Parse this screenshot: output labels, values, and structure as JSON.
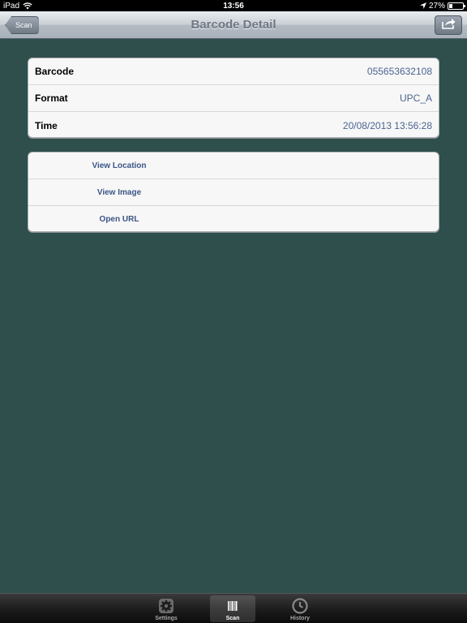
{
  "status_bar": {
    "device": "iPad",
    "time": "13:56",
    "battery": "27%",
    "battery_level": 0.27
  },
  "nav": {
    "title": "Barcode Detail",
    "back_label": "Scan",
    "share_icon": "share-icon"
  },
  "details": [
    {
      "label": "Barcode",
      "value": "055653632108"
    },
    {
      "label": "Format",
      "value": "UPC_A"
    },
    {
      "label": "Time",
      "value": "20/08/2013 13:56:28"
    }
  ],
  "actions": [
    {
      "label": "View Location"
    },
    {
      "label": "View Image"
    },
    {
      "label": "Open URL"
    }
  ],
  "tabs": [
    {
      "label": "Settings",
      "icon": "gear-icon",
      "selected": false
    },
    {
      "label": "Scan",
      "icon": "barcode-icon",
      "selected": true
    },
    {
      "label": "History",
      "icon": "clock-icon",
      "selected": false
    }
  ],
  "colors": {
    "background": "#2f4f4c",
    "value_text": "#4a6490",
    "action_text": "#3b5588"
  }
}
